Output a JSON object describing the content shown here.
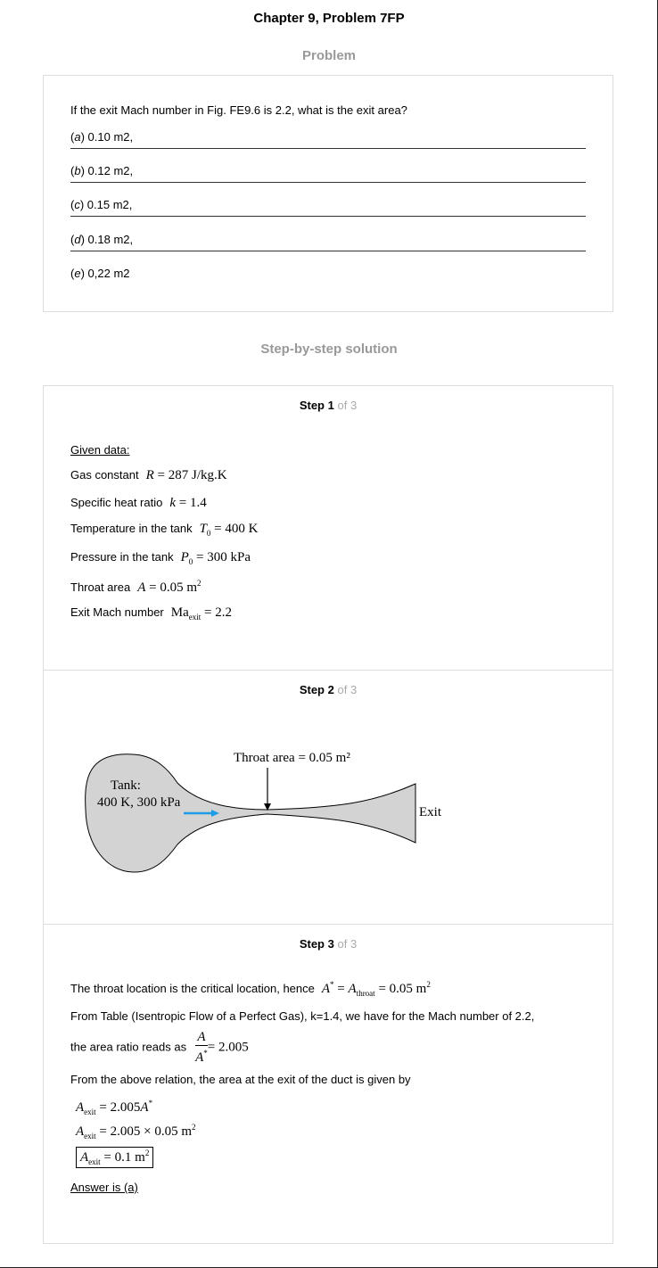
{
  "header": {
    "title": "Chapter 9, Problem 7FP"
  },
  "problem": {
    "heading": "Problem",
    "question": "If the exit Mach number in Fig. FE9.6 is 2.2, what is the exit area?",
    "options": [
      {
        "letter": "a",
        "text": " 0.10 m2,"
      },
      {
        "letter": "b",
        "text": " 0.12 m2,"
      },
      {
        "letter": "c",
        "text": " 0.15 m2,"
      },
      {
        "letter": "d",
        "text": " 0.18 m2,"
      },
      {
        "letter": "e",
        "text": " 0,22 m2"
      }
    ]
  },
  "solution": {
    "heading": "Step-by-step solution",
    "step_word": "Step",
    "of_total": "of 3",
    "step1": {
      "number": "1",
      "given_label": "Given data:",
      "rows": [
        {
          "label": "Gas constant",
          "equation": "R = 287 J/kg.K"
        },
        {
          "label": "Specific heat ratio",
          "equation": "k = 1.4"
        },
        {
          "label": "Temperature in the tank",
          "equation": "T0 = 400 K"
        },
        {
          "label": "Pressure in the tank",
          "equation": "P0 = 300 kPa"
        },
        {
          "label": "Throat area",
          "equation": "A = 0.05 m2"
        },
        {
          "label": "Exit Mach number",
          "equation": "Maexit = 2.2"
        }
      ]
    },
    "step2": {
      "number": "2",
      "figure": {
        "throat_label": "Throat area = 0.05 m²",
        "tank_label": "Tank:",
        "tank_conditions": "400 K, 300 kPa",
        "exit_label": "Exit",
        "nozzle_fill": "#d3d3d3",
        "arrow_color": "#1e9be6"
      }
    },
    "step3": {
      "number": "3",
      "line1": "The throat location is the critical location, hence",
      "line2": "From Table (Isentropic Flow of a Perfect Gas), k=1.4, we have for the Mach number of 2.2,",
      "line3": "the area ratio reads as",
      "ratio_value": "= 2.005",
      "line4": "From the above relation, the area at the exit of the duct is given by",
      "eq1_rhs": "= 2.005",
      "eq2_rhs": "= 2.005 × 0.05 m",
      "eq3_rhs": "= 0.1 m",
      "answer": "Answer is (a)"
    }
  }
}
